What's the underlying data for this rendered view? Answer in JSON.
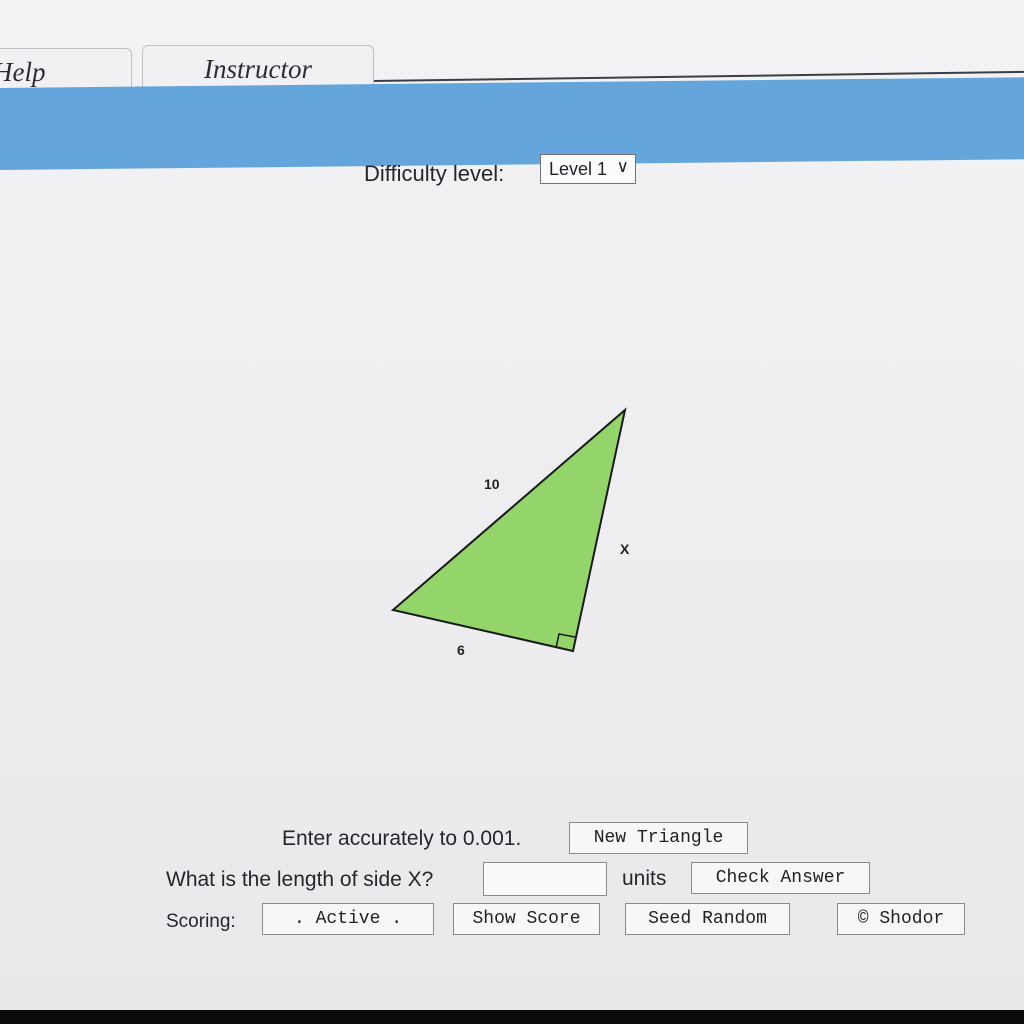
{
  "tabs": {
    "help": "Help",
    "instructor": "Instructor"
  },
  "difficulty": {
    "label": "Difficulty level:",
    "selected": "Level 1"
  },
  "triangle": {
    "hypotenuse_label": "10",
    "base_label": "6",
    "unknown_label": "X",
    "fill_color": "#93d56a"
  },
  "controls": {
    "accuracy_text": "Enter accurately to 0.001.",
    "new_triangle": "New Triangle",
    "question": "What is the length of side X?",
    "answer_value": "",
    "units": "units",
    "check_answer": "Check Answer",
    "scoring_label": "Scoring:",
    "active": ".   Active   .",
    "show_score": "Show Score",
    "seed_random": "Seed Random",
    "shodor": "© Shodor"
  }
}
